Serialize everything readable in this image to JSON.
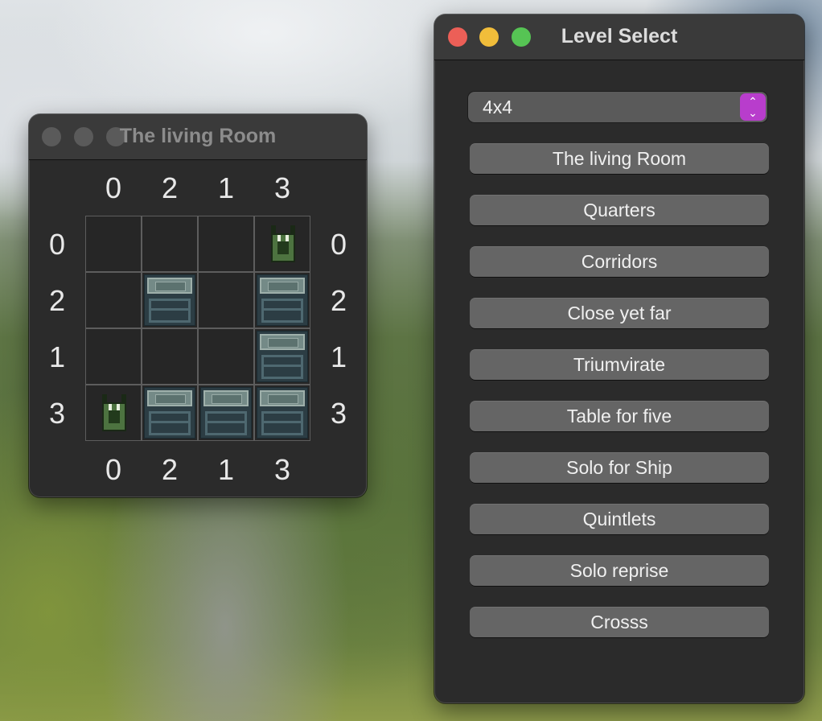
{
  "game_window": {
    "title": "The living Room",
    "clues": {
      "top": [
        "0",
        "2",
        "1",
        "3"
      ],
      "bottom": [
        "0",
        "2",
        "1",
        "3"
      ],
      "left": [
        "0",
        "2",
        "1",
        "3"
      ],
      "right": [
        "0",
        "2",
        "1",
        "3"
      ]
    },
    "grid": [
      [
        "empty",
        "empty",
        "empty",
        "monster"
      ],
      [
        "empty",
        "chest",
        "empty",
        "chest"
      ],
      [
        "empty",
        "empty",
        "empty",
        "chest"
      ],
      [
        "monster",
        "chest",
        "chest",
        "chest"
      ]
    ],
    "cell_icons": {
      "monster": "monster-icon",
      "chest": "treasure-chest-icon"
    }
  },
  "level_window": {
    "title": "Level Select",
    "size_select": {
      "value": "4x4",
      "arrows_icon": "up-down-chevron-icon",
      "accent_color": "#b83dcc"
    },
    "levels": [
      "The living Room",
      "Quarters",
      "Corridors",
      "Close yet far",
      "Triumvirate",
      "Table for five",
      "Solo for Ship",
      "Quintlets",
      "Solo reprise",
      "Crosss"
    ]
  },
  "window_controls": {
    "close_color": "#ec5f57",
    "minimize_color": "#f1bd3a",
    "zoom_color": "#56c454",
    "inactive_color": "#5a5a5a"
  }
}
